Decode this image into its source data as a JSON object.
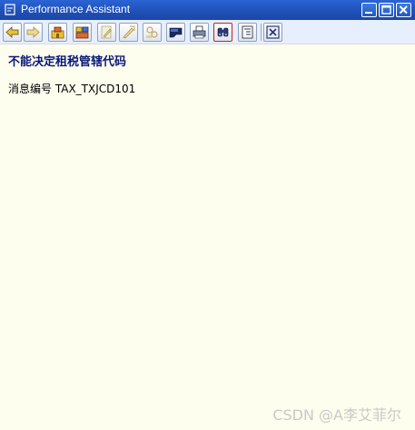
{
  "window": {
    "title": "Performance Assistant"
  },
  "toolbar": {
    "buttons": [
      "back-icon",
      "forward-icon",
      "technical-info-icon",
      "display-object-icon",
      "edit-icon",
      "edit-translation-icon",
      "link-icon",
      "document-icon",
      "print-icon",
      "find-icon",
      "structure-icon",
      "close-icon"
    ]
  },
  "content": {
    "heading": "不能决定租税管辖代码",
    "message_label": "消息编号",
    "message_id": "TAX_TXJCD101"
  },
  "watermark": "CSDN @A李艾菲尔",
  "colors": {
    "titlebar": "#1f4fb6",
    "background": "#fefeee",
    "heading": "#0b1a78"
  }
}
